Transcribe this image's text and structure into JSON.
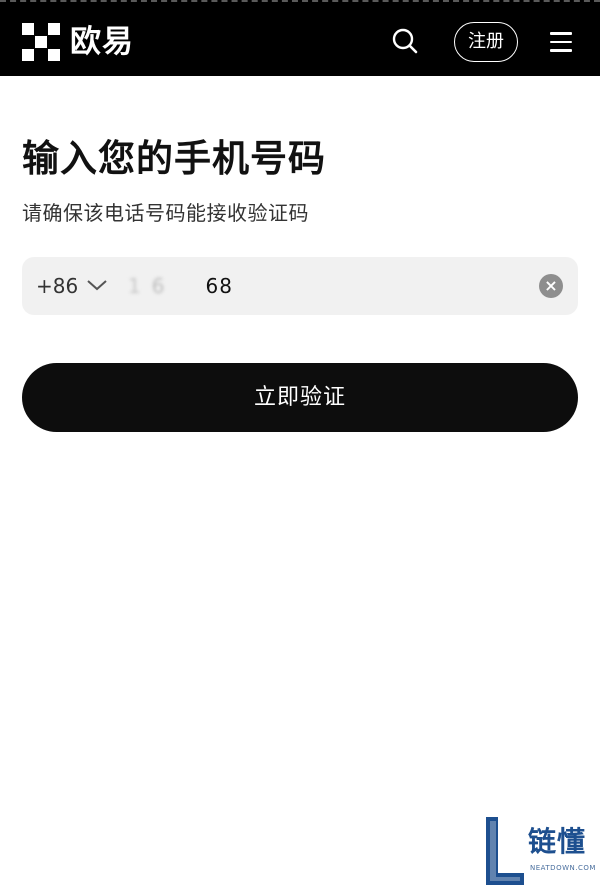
{
  "header": {
    "logo_text": "欧易",
    "register_label": "注册",
    "icons": [
      "okx-logo-icon",
      "search-icon",
      "menu-icon"
    ],
    "background": "#000000"
  },
  "main": {
    "title": "输入您的手机号码",
    "subtitle": "请确保该电话号码能接收验证码",
    "phone_field": {
      "country_code": "+86",
      "value_masked_start": "1",
      "value_masked_mid": "6",
      "value_tail": "68"
    },
    "verify_button_label": "立即验证",
    "button_color": "#0d0d0d",
    "field_background": "#f1f1f1"
  },
  "watermark": {
    "text": "链懂",
    "subtext": "NEATDOWN.COM"
  }
}
